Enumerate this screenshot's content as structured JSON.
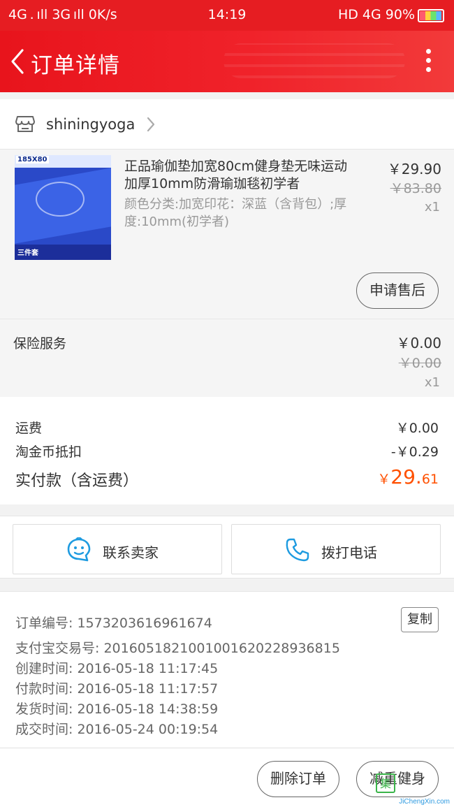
{
  "status_bar": {
    "left": "4G . ıll 3G ıll 0K/s",
    "time": "14:19",
    "right": "HD 4G 90%",
    "battery_level": 0.9
  },
  "header": {
    "title": "订单详情"
  },
  "shop": {
    "name": "shiningyoga"
  },
  "product": {
    "title": "正品瑜伽垫加宽80cm健身垫无味运动加厚10mm防滑瑜珈毯初学者",
    "spec": "颜色分类:加宽印花：深蓝（含背包）;厚度:10mm(初学者)",
    "price": "￥29.90",
    "original_price": "￥83.80",
    "quantity": "x1",
    "thumb_size_label": "185X80",
    "thumb_set_label": "三件套",
    "after_sale_label": "申请售后"
  },
  "insurance": {
    "label": "保险服务",
    "price": "￥0.00",
    "original_price": "￥0.00",
    "quantity": "x1"
  },
  "summary": {
    "shipping_label": "运费",
    "shipping_value": "￥0.00",
    "coin_label": "淘金币抵扣",
    "coin_value": "-￥0.29",
    "total_label": "实付款（含运费）",
    "total_currency": "￥",
    "total_int": "29.",
    "total_dec": "61",
    "total_color": "#ff5000"
  },
  "contact": {
    "seller_label": "联系卖家",
    "phone_label": "拨打电话",
    "icon_color": "#1e9be0"
  },
  "info": {
    "order_no": "订单编号: 1573203616961674",
    "copy_label": "复制",
    "alipay_no": "支付宝交易号: 2016051821001001620228936815",
    "created": "创建时间: 2016-05-18 11:17:45",
    "paid": "付款时间: 2016-05-18 11:17:57",
    "shipped": "发货时间: 2016-05-18 14:38:59",
    "completed": "成交时间: 2016-05-24 00:19:54"
  },
  "footer": {
    "delete_label": "删除订单",
    "second_label": "减重健身",
    "watermark_text": "JiChengXin.com"
  },
  "colors": {
    "brand_red": "#e61d22",
    "accent_orange": "#ff5000"
  }
}
